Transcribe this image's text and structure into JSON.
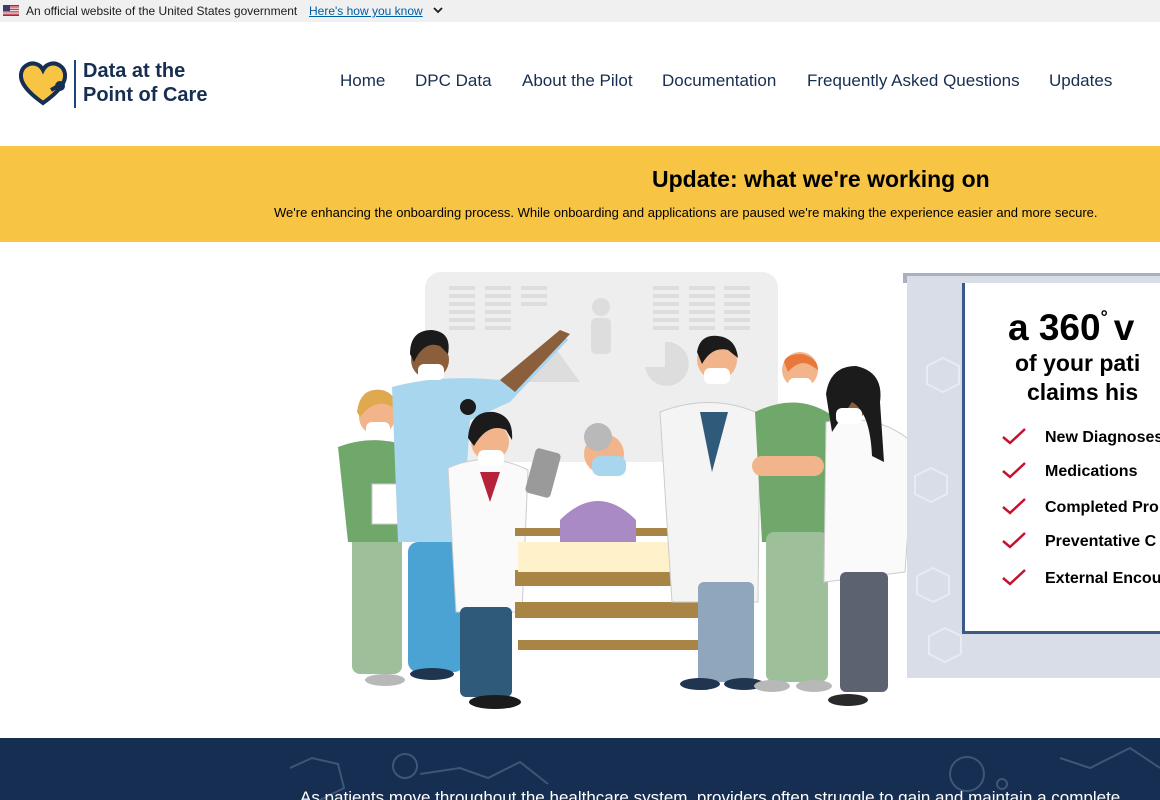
{
  "gov_banner": {
    "text": "An official website of the United States government",
    "link": "Here's how you know"
  },
  "logo": {
    "line1": "Data at the",
    "line2": "Point of Care"
  },
  "nav": {
    "items": [
      "Home",
      "DPC Data",
      "About the Pilot",
      "Documentation",
      "Frequently Asked Questions",
      "Updates"
    ]
  },
  "update": {
    "title": "Update: what we're working on",
    "body": "We're enhancing the onboarding process. While onboarding and applications are paused we're making the experience easier and more secure."
  },
  "hero_board": {
    "title_a": "a 360",
    "title_deg": "°",
    "title_v": "v",
    "sub1": "of your pati",
    "sub2": "claims his",
    "items": [
      "New Diagnoses",
      "Medications",
      "Completed Pro",
      "Preventative C",
      "External Encou"
    ]
  },
  "footer": {
    "text": "As patients move throughout the healthcare system, providers often struggle to gain and maintain a complete"
  },
  "colors": {
    "navy": "#162e51",
    "gold": "#f7c443",
    "link": "#005ea2",
    "check": "#c8102e"
  }
}
